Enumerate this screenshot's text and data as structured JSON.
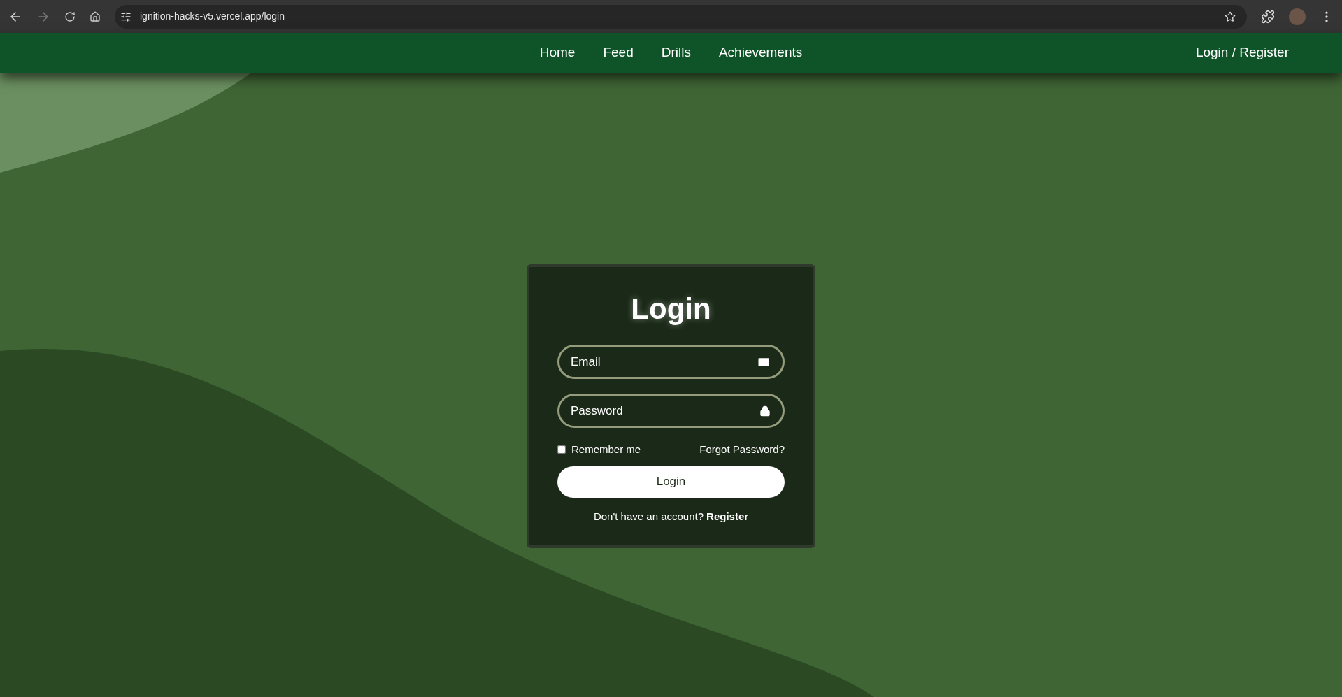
{
  "browser": {
    "url": "ignition-hacks-v5.vercel.app/login"
  },
  "nav": {
    "links": [
      "Home",
      "Feed",
      "Drills",
      "Achievements"
    ],
    "auth_link": "Login / Register"
  },
  "login_card": {
    "title": "Login",
    "fields": [
      {
        "kind": "email",
        "placeholder": "Email"
      },
      {
        "kind": "password",
        "placeholder": "Password"
      }
    ],
    "remember": {
      "label": "Remember me",
      "checked": false
    },
    "forgot_link": "Forgot Password?",
    "submit": "Login",
    "footer_text": "Don't have an account?",
    "footer_link": "Register"
  }
}
